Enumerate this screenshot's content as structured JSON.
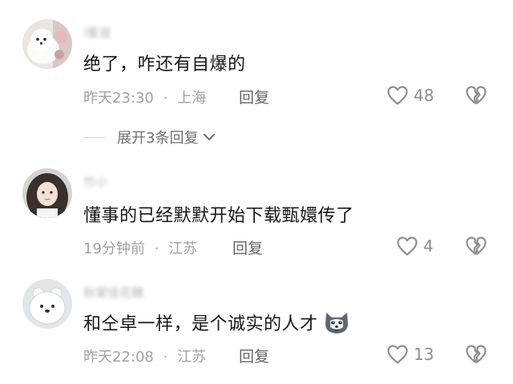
{
  "comments": [
    {
      "username": "i蜜淑",
      "text": "绝了，咋还有自爆的",
      "time": "昨天23:30",
      "dot": "·",
      "location": "上海",
      "reply_label": "回复",
      "likes": "48",
      "expand_label": "展开3条回复"
    },
    {
      "username": "竹小",
      "text": "懂事的已经默默开始下载甄嬛传了",
      "time": "19分钟前",
      "dot": "·",
      "location": "江苏",
      "reply_label": "回复",
      "likes": "4"
    },
    {
      "username": "秋棠佳花糖",
      "text": "和仝卓一样，是个诚实的人才",
      "time": "昨天22:08",
      "dot": "·",
      "location": "江苏",
      "reply_label": "回复",
      "likes": "13"
    }
  ],
  "icons": {
    "like": "heart-outline-icon",
    "dislike": "broken-heart-icon",
    "expand": "chevron-down-icon",
    "emoji": "husky-dog-emoji"
  },
  "colors": {
    "text": "#161616",
    "meta": "#a1a1a1",
    "icon": "#8e8e8e"
  }
}
